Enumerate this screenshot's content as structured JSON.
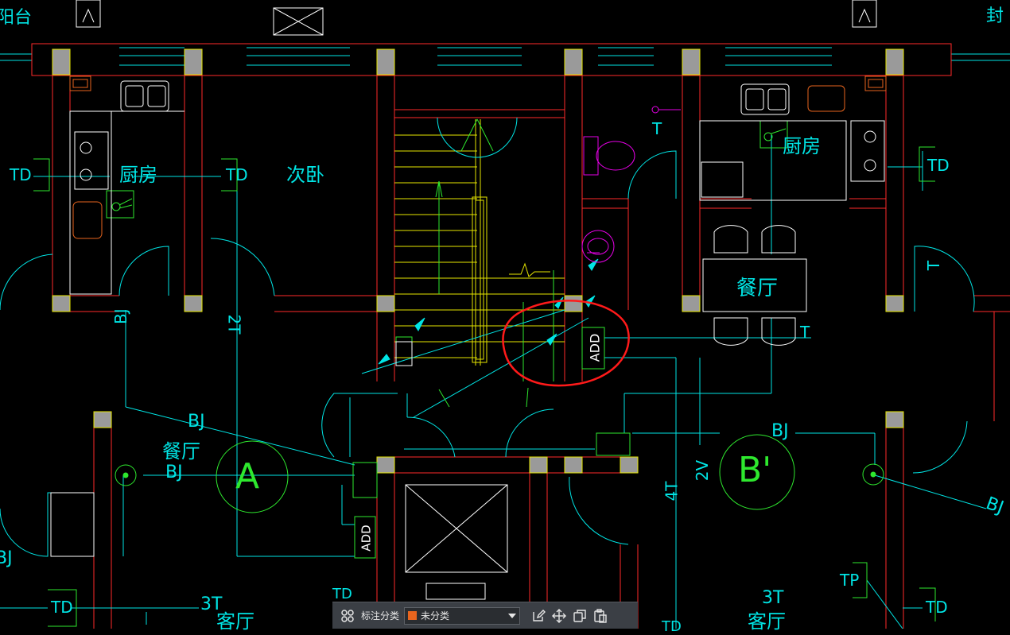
{
  "colors": {
    "wall": "#ff2a2a",
    "cyan": "#00e5e5",
    "yellow": "#e6e600",
    "green": "#2ee82e",
    "magenta": "#e600e6",
    "white": "#ffffff",
    "column_fill": "#9a9a9a",
    "annotation_circle": "#ff1a1a",
    "category_swatch": "#e8651e"
  },
  "labels": {
    "balcony_left": "阳台",
    "seal_right": "封",
    "kitchen_left": "厨房",
    "kitchen_right": "厨房",
    "second_bedroom": "次卧",
    "dining_right": "餐厅",
    "dining_left": "餐厅",
    "living_bottom_left": "客厅",
    "living_bottom_right": "客厅",
    "td_1": "TD",
    "td_2": "TD",
    "td_3": "TD",
    "td_4": "TD",
    "td_5": "TD",
    "td_6": "TD",
    "td_7": "TD",
    "tp": "TP",
    "bj_1": "BJ",
    "bj_2": "BJ",
    "bj_3": "BJ",
    "bj_4": "BJ",
    "bj_5": "BJ",
    "bj_6": "BJ",
    "t_1": "2T",
    "t_2": "T",
    "t_3": "T",
    "t_4": "4T",
    "t_5": "2V",
    "t_6": "3T",
    "t_7": "3T",
    "t_8": "T",
    "add_1": "ADD",
    "add_2": "ADD",
    "axis_a": "A",
    "axis_b": "B'"
  },
  "toolbar": {
    "category_label": "标注分类",
    "category_value": "未分类"
  },
  "icons": {
    "grid": "grid-icon",
    "dropdown": "chevron-down-icon",
    "edit": "edit-icon",
    "move": "move-icon",
    "copy": "copy-icon",
    "paste": "paste-icon"
  }
}
